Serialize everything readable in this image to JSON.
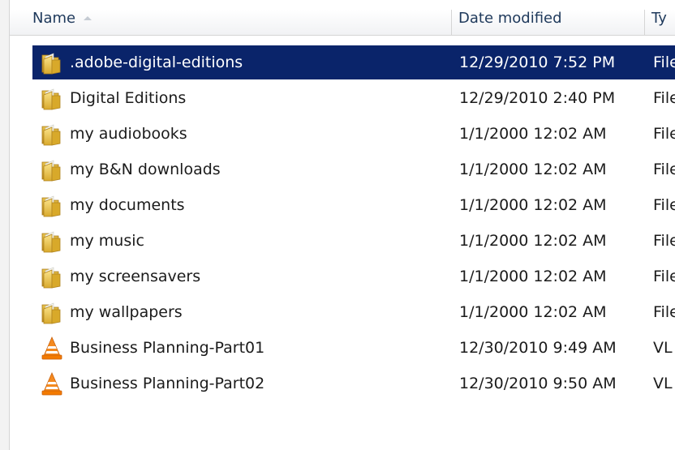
{
  "columns": {
    "name": "Name",
    "date_modified": "Date modified",
    "type": "Ty"
  },
  "rows": [
    {
      "name": ".adobe-digital-editions",
      "date": "12/29/2010 7:52 PM",
      "type": "File",
      "icon": "folder-icon",
      "selected": true
    },
    {
      "name": "Digital Editions",
      "date": "12/29/2010 2:40 PM",
      "type": "File",
      "icon": "folder-icon"
    },
    {
      "name": "my audiobooks",
      "date": "1/1/2000 12:02 AM",
      "type": "File",
      "icon": "folder-icon"
    },
    {
      "name": "my B&N downloads",
      "date": "1/1/2000 12:02 AM",
      "type": "File",
      "icon": "folder-icon"
    },
    {
      "name": "my documents",
      "date": "1/1/2000 12:02 AM",
      "type": "File",
      "icon": "folder-icon"
    },
    {
      "name": "my music",
      "date": "1/1/2000 12:02 AM",
      "type": "File",
      "icon": "folder-icon"
    },
    {
      "name": "my screensavers",
      "date": "1/1/2000 12:02 AM",
      "type": "File",
      "icon": "folder-icon"
    },
    {
      "name": "my wallpapers",
      "date": "1/1/2000 12:02 AM",
      "type": "File",
      "icon": "folder-icon"
    },
    {
      "name": "Business Planning-Part01",
      "date": "12/30/2010 9:49 AM",
      "type": "VL",
      "icon": "vlc-icon"
    },
    {
      "name": "Business Planning-Part02",
      "date": "12/30/2010 9:50 AM",
      "type": "VL",
      "icon": "vlc-icon"
    }
  ],
  "colors": {
    "selection": "#0a246a",
    "header_text": "#1e395b",
    "folder": "#e8c24a",
    "vlc": "#f37a00"
  }
}
